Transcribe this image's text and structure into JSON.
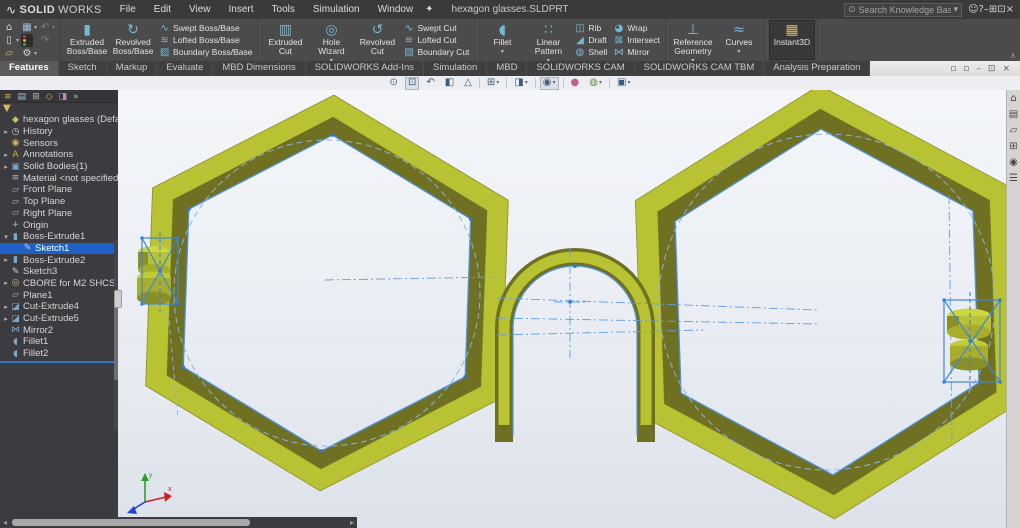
{
  "colors": {
    "model_yellow_face": "#b9c232",
    "model_olive_side": "#6f7021",
    "sketch_blue": "#4d92dd",
    "centerline_blue": "#5f9fe0",
    "selection_blue": "#1e62c8",
    "titlebar_bg": "#3a3a3a",
    "ribbon_bg": "#4b4b4b"
  },
  "titlebar": {
    "logo_prefix": "SOLID",
    "logo_suffix": "WORKS",
    "menus": [
      "File",
      "Edit",
      "View",
      "Insert",
      "Tools",
      "Simulation",
      "Window"
    ],
    "doc_title": "hexagon glasses.SLDPRT",
    "search_placeholder": "Search Knowledge Base",
    "right_icons": [
      "user-account",
      "help",
      "minimize-window",
      "window-grid",
      "restore-window",
      "close-window"
    ]
  },
  "ribbon": {
    "quick": [
      {
        "icon": "home"
      },
      {
        "icon": "save",
        "dropdown": true
      },
      {
        "icon": "undo",
        "dropdown": true,
        "disabled": true
      },
      {
        "icon": "new-file",
        "dropdown": true
      },
      {
        "icon": "rebuild"
      },
      {
        "icon": "redo",
        "disabled": true
      },
      {
        "icon": "open"
      },
      {
        "icon": "options",
        "dropdown": true
      }
    ],
    "groups": [
      {
        "buttons": [
          {
            "label": "Extruded Boss/Base",
            "icon": "extruded-boss",
            "size": "large"
          },
          {
            "label": "Revolved Boss/Base",
            "icon": "revolved-boss",
            "size": "large"
          },
          {
            "stack": [
              {
                "label": "Swept Boss/Base",
                "icon": "swept-boss"
              },
              {
                "label": "Lofted Boss/Base",
                "icon": "lofted-boss"
              },
              {
                "label": "Boundary Boss/Base",
                "icon": "boundary-boss"
              }
            ]
          }
        ]
      },
      {
        "buttons": [
          {
            "label": "Extruded Cut",
            "icon": "extruded-cut",
            "size": "large"
          },
          {
            "label": "Hole Wizard",
            "icon": "hole-wizard",
            "size": "large",
            "dropdown": true
          },
          {
            "label": "Revolved Cut",
            "icon": "revolved-cut",
            "size": "large"
          },
          {
            "stack": [
              {
                "label": "Swept Cut",
                "icon": "swept-cut"
              },
              {
                "label": "Lofted Cut",
                "icon": "lofted-cut"
              },
              {
                "label": "Boundary Cut",
                "icon": "boundary-cut"
              }
            ]
          }
        ]
      },
      {
        "buttons": [
          {
            "label": "Fillet",
            "icon": "fillet",
            "size": "large",
            "dropdown": true
          },
          {
            "label": "Linear Pattern",
            "icon": "linear-pattern",
            "size": "large",
            "dropdown": true
          },
          {
            "stack": [
              {
                "label": "Rib",
                "icon": "rib"
              },
              {
                "label": "Draft",
                "icon": "draft"
              },
              {
                "label": "Shell",
                "icon": "shell"
              }
            ]
          },
          {
            "stack": [
              {
                "label": "Wrap",
                "icon": "wrap"
              },
              {
                "label": "Intersect",
                "icon": "intersect"
              },
              {
                "label": "Mirror",
                "icon": "mirror"
              }
            ]
          }
        ]
      },
      {
        "buttons": [
          {
            "label": "Reference Geometry",
            "icon": "reference-geometry",
            "size": "large",
            "dropdown": true
          },
          {
            "label": "Curves",
            "icon": "curves",
            "size": "large",
            "dropdown": true
          }
        ]
      },
      {
        "buttons": [
          {
            "label": "Instant3D",
            "icon": "instant3d",
            "size": "large",
            "active": true
          }
        ]
      }
    ]
  },
  "tabs": [
    {
      "label": "Features",
      "active": true
    },
    {
      "label": "Sketch"
    },
    {
      "label": "Markup"
    },
    {
      "label": "Evaluate"
    },
    {
      "label": "MBD Dimensions"
    },
    {
      "label": "SOLIDWORKS Add-Ins"
    },
    {
      "label": "Simulation"
    },
    {
      "label": "MBD"
    },
    {
      "label": "SOLIDWORKS CAM"
    },
    {
      "label": "SOLIDWORKS CAM TBM"
    },
    {
      "label": "Analysis Preparation"
    }
  ],
  "doc_controls": [
    "pane-left",
    "pane-right",
    "minimize-doc",
    "restore-doc",
    "close-doc"
  ],
  "headsup": [
    {
      "icon": "zoom-fit"
    },
    {
      "icon": "zoom-area",
      "active": true
    },
    {
      "icon": "previous-view"
    },
    {
      "icon": "section-view"
    },
    {
      "icon": "annotation-views"
    },
    {
      "sep": true
    },
    {
      "icon": "view-orientation",
      "dropdown": true
    },
    {
      "sep": true
    },
    {
      "icon": "display-style",
      "dropdown": true
    },
    {
      "sep": true
    },
    {
      "icon": "hide-show-items",
      "active": true,
      "dropdown": true
    },
    {
      "sep": true
    },
    {
      "icon": "edit-appearance"
    },
    {
      "icon": "apply-scene",
      "dropdown": true
    },
    {
      "sep": true
    },
    {
      "icon": "view-settings",
      "dropdown": true
    }
  ],
  "panel": {
    "tabs": [
      "feature-manager",
      "property-manager",
      "configuration-manager",
      "dimxpert-manager",
      "display-manager",
      "tab-overflow"
    ],
    "tree": [
      {
        "label": "hexagon glasses (Default) <<Defa",
        "icon": "part"
      },
      {
        "label": "History",
        "icon": "history",
        "arrow": "right"
      },
      {
        "label": "Sensors",
        "icon": "sensors"
      },
      {
        "label": "Annotations",
        "icon": "annotations",
        "arrow": "right"
      },
      {
        "label": "Solid Bodies(1)",
        "icon": "solid-bodies",
        "arrow": "right"
      },
      {
        "label": "Material <not specified>",
        "icon": "material"
      },
      {
        "label": "Front Plane",
        "icon": "plane"
      },
      {
        "label": "Top Plane",
        "icon": "plane"
      },
      {
        "label": "Right Plane",
        "icon": "plane"
      },
      {
        "label": "Origin",
        "icon": "origin"
      },
      {
        "label": "Boss-Extrude1",
        "icon": "boss-extrude",
        "arrow": "down"
      },
      {
        "label": "Sketch1",
        "icon": "sketch",
        "indent": 1,
        "selected": true
      },
      {
        "label": "Boss-Extrude2",
        "icon": "boss-extrude",
        "arrow": "right"
      },
      {
        "label": "Sketch3",
        "icon": "sketch"
      },
      {
        "label": "CBORE for M2 SHCS1",
        "icon": "hole-cbore",
        "arrow": "right"
      },
      {
        "label": "Plane1",
        "icon": "plane"
      },
      {
        "label": "Cut-Extrude4",
        "icon": "cut-extrude",
        "arrow": "right"
      },
      {
        "label": "Cut-Extrude5",
        "icon": "cut-extrude",
        "arrow": "right"
      },
      {
        "label": "Mirror2",
        "icon": "mirror-feature"
      },
      {
        "label": "Fillet1",
        "icon": "fillet-feature"
      },
      {
        "label": "Fillet2",
        "icon": "fillet-feature"
      }
    ]
  },
  "taskpane": [
    "taskpane-home",
    "design-library",
    "file-explorer",
    "view-palette",
    "appearances",
    "custom-properties"
  ],
  "viewport": {
    "triad": {
      "x_label": "x",
      "y_label": "y"
    }
  },
  "icons": {
    "home": {
      "g": "⌂",
      "c": "#d9d9d9"
    },
    "save": {
      "g": "▦",
      "c": "#9fc2dd"
    },
    "undo": {
      "g": "↶",
      "c": "#bdbdbd"
    },
    "new-file": {
      "g": "▯",
      "c": "#d9d9d9"
    },
    "rebuild": {
      "g": "",
      "c": "",
      "special": "traffic"
    },
    "redo": {
      "g": "↷",
      "c": "#bdbdbd"
    },
    "open": {
      "g": "▱",
      "c": "#d7b65c"
    },
    "options": {
      "g": "⚙",
      "c": "#d9d9d9"
    },
    "extruded-boss": {
      "g": "▮",
      "c": "#74b8d6"
    },
    "revolved-boss": {
      "g": "↻",
      "c": "#74b8d6"
    },
    "swept-boss": {
      "g": "∿",
      "c": "#74b8d6"
    },
    "lofted-boss": {
      "g": "≋",
      "c": "#74b8d6"
    },
    "boundary-boss": {
      "g": "▨",
      "c": "#74b8d6"
    },
    "extruded-cut": {
      "g": "▥",
      "c": "#74b8d6"
    },
    "hole-wizard": {
      "g": "◎",
      "c": "#74b8d6"
    },
    "revolved-cut": {
      "g": "↺",
      "c": "#74b8d6"
    },
    "swept-cut": {
      "g": "∿",
      "c": "#74b8d6"
    },
    "lofted-cut": {
      "g": "≋",
      "c": "#74b8d6"
    },
    "boundary-cut": {
      "g": "▧",
      "c": "#74b8d6"
    },
    "fillet": {
      "g": "◖",
      "c": "#74b8d6"
    },
    "linear-pattern": {
      "g": "∷",
      "c": "#74b8d6"
    },
    "rib": {
      "g": "◫",
      "c": "#74b8d6"
    },
    "draft": {
      "g": "◢",
      "c": "#74b8d6"
    },
    "shell": {
      "g": "◍",
      "c": "#74b8d6"
    },
    "wrap": {
      "g": "◕",
      "c": "#74b8d6"
    },
    "intersect": {
      "g": "⊠",
      "c": "#74b8d6"
    },
    "mirror": {
      "g": "⋈",
      "c": "#74b8d6"
    },
    "reference-geometry": {
      "g": "⊥",
      "c": "#74b8d6"
    },
    "curves": {
      "g": "≈",
      "c": "#74b8d6"
    },
    "instant3d": {
      "g": "▦",
      "c": "#d7b65c"
    },
    "zoom-fit": {
      "g": "⊙",
      "c": "#3c5a78"
    },
    "zoom-area": {
      "g": "⊡",
      "c": "#3c5a78"
    },
    "previous-view": {
      "g": "↶",
      "c": "#3c5a78"
    },
    "section-view": {
      "g": "◧",
      "c": "#3c5a78"
    },
    "annotation-views": {
      "g": "△",
      "c": "#3c5a78"
    },
    "view-orientation": {
      "g": "⊞",
      "c": "#3c5a78"
    },
    "display-style": {
      "g": "◨",
      "c": "#3c5a78"
    },
    "hide-show-items": {
      "g": "◉",
      "c": "#3c5a78"
    },
    "edit-appearance": {
      "g": "●",
      "c": "#c06090"
    },
    "apply-scene": {
      "g": "◍",
      "c": "#6a8f4f"
    },
    "view-settings": {
      "g": "▣",
      "c": "#3c5a78"
    },
    "feature-manager": {
      "g": "≡",
      "c": "#d7b65c"
    },
    "property-manager": {
      "g": "▤",
      "c": "#9fc2dd"
    },
    "configuration-manager": {
      "g": "⊞",
      "c": "#b8b8b8"
    },
    "dimxpert-manager": {
      "g": "◇",
      "c": "#d7b65c"
    },
    "display-manager": {
      "g": "◨",
      "c": "#b88bb0"
    },
    "tab-overflow": {
      "g": "»",
      "c": "#bbbbbb"
    },
    "funnel-filter": {
      "g": "▼",
      "c": "#d7b65c"
    },
    "part": {
      "g": "◆",
      "c": "#d7b65c"
    },
    "history": {
      "g": "◷",
      "c": "#cfcfcf"
    },
    "sensors": {
      "g": "◉",
      "c": "#d7b65c"
    },
    "annotations": {
      "g": "A",
      "c": "#cfa93f"
    },
    "solid-bodies": {
      "g": "▣",
      "c": "#74a8d0"
    },
    "material": {
      "g": "≡",
      "c": "#a8bfcf"
    },
    "plane": {
      "g": "▱",
      "c": "#8fb8d8"
    },
    "origin": {
      "g": "+",
      "c": "#8fb8d8"
    },
    "boss-extrude": {
      "g": "▮",
      "c": "#74a8d0"
    },
    "sketch": {
      "g": "✎",
      "c": "#cfcfcf"
    },
    "hole-cbore": {
      "g": "◎",
      "c": "#d7b65c"
    },
    "cut-extrude": {
      "g": "◪",
      "c": "#74a8d0"
    },
    "mirror-feature": {
      "g": "⋈",
      "c": "#74a8d0"
    },
    "fillet-feature": {
      "g": "◖",
      "c": "#74a8d0"
    },
    "taskpane-home": {
      "g": "⌂",
      "c": "#4a4a4a"
    },
    "design-library": {
      "g": "▤",
      "c": "#4a4a4a"
    },
    "file-explorer": {
      "g": "▱",
      "c": "#4a4a4a"
    },
    "view-palette": {
      "g": "⊞",
      "c": "#4a4a4a"
    },
    "appearances": {
      "g": "◉",
      "c": "#4a4a4a"
    },
    "custom-properties": {
      "g": "☰",
      "c": "#4a4a4a"
    },
    "user-account": {
      "g": "☺",
      "c": "#d5d5d5"
    },
    "help": {
      "g": "?",
      "c": "#d5d5d5"
    },
    "minimize-window": {
      "g": "–",
      "c": "#d5d5d5"
    },
    "window-grid": {
      "g": "⊞",
      "c": "#d5d5d5"
    },
    "restore-window": {
      "g": "⊡",
      "c": "#d5d5d5"
    },
    "close-window": {
      "g": "×",
      "c": "#d5d5d5"
    },
    "pane-left": {
      "g": "▫",
      "c": "#5a5a5a"
    },
    "pane-right": {
      "g": "▫",
      "c": "#5a5a5a"
    },
    "minimize-doc": {
      "g": "–",
      "c": "#5a5a5a"
    },
    "restore-doc": {
      "g": "⊡",
      "c": "#5a5a5a"
    },
    "close-doc": {
      "g": "×",
      "c": "#5a5a5a"
    },
    "search": {
      "g": "⊙",
      "c": "#a8a8a8"
    },
    "search-dropdown": {
      "g": "▾",
      "c": "#a8a8a8"
    },
    "pin": {
      "g": "✦",
      "c": "#d9d9d9"
    },
    "logo": {
      "g": "∿",
      "c": "#e8e8e8"
    }
  }
}
